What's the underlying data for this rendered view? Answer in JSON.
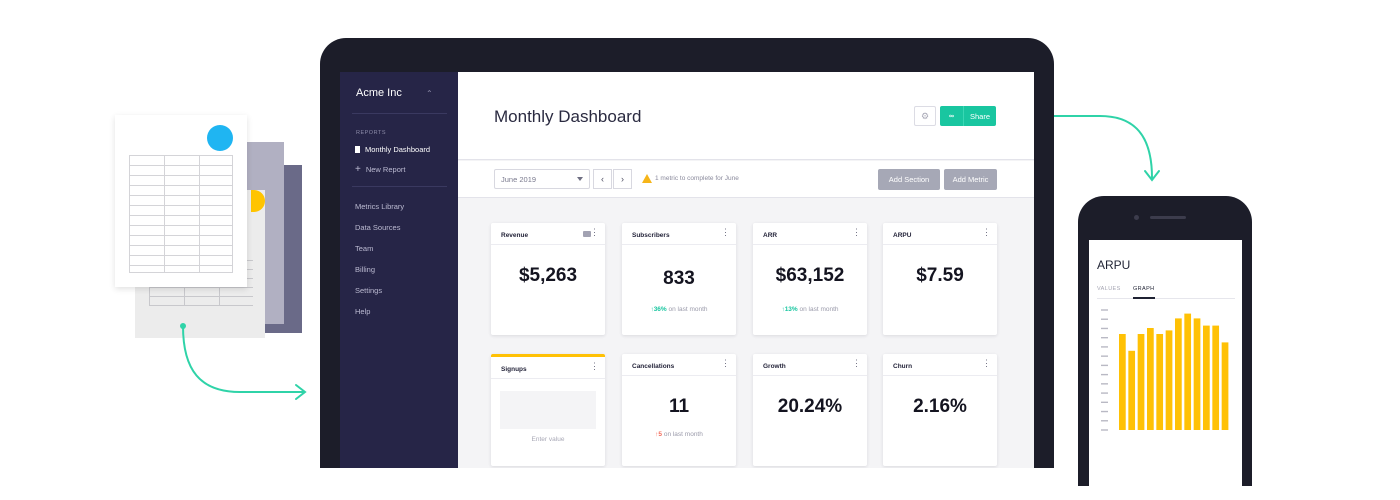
{
  "colors": {
    "accent": "#19c6a0",
    "sidebar": "#262547",
    "chart_bar": "#ffc105",
    "signups_accent": "#ffc105",
    "up": "#19c6a0",
    "down": "#f36b5a"
  },
  "sidebar": {
    "org_name": "Acme Inc",
    "section_label": "REPORTS",
    "reports": [
      {
        "label": "Monthly Dashboard",
        "icon": "document-icon",
        "active": true
      },
      {
        "label": "New Report",
        "icon": "plus-icon",
        "active": false
      }
    ],
    "items": [
      {
        "label": "Metrics Library"
      },
      {
        "label": "Data Sources"
      },
      {
        "label": "Team"
      },
      {
        "label": "Billing"
      },
      {
        "label": "Settings"
      },
      {
        "label": "Help"
      }
    ]
  },
  "header": {
    "title": "Monthly Dashboard",
    "share_label": "Share",
    "share_icon": "link-icon",
    "settings_icon": "gear-icon"
  },
  "toolbar": {
    "month": "June 2019",
    "warning": "1 metric to complete for June",
    "add_section": "Add Section",
    "add_metric": "Add Metric"
  },
  "cards": [
    {
      "title": "Revenue",
      "value": "$5,263"
    },
    {
      "title": "Subscribers",
      "value": "833",
      "delta": "36%",
      "delta_dir": "up",
      "delta_note": "on last month"
    },
    {
      "title": "ARR",
      "value": "$63,152",
      "delta": "13%",
      "delta_dir": "up",
      "delta_note": "on last month"
    },
    {
      "title": "ARPU",
      "value": "$7.59"
    },
    {
      "title": "Signups",
      "placeholder": "Enter value"
    },
    {
      "title": "Cancellations",
      "value": "11",
      "delta": "5",
      "delta_dir": "down",
      "delta_note": "on last month"
    },
    {
      "title": "Growth",
      "value": "20.24%"
    },
    {
      "title": "Churn",
      "value": "2.16%"
    }
  ],
  "phone": {
    "title": "ARPU",
    "tabs": [
      "VALUES",
      "GRAPH"
    ],
    "active_tab": "GRAPH"
  },
  "chart_data": {
    "type": "bar",
    "title": "ARPU",
    "values": [
      0.8,
      0.66,
      0.8,
      0.85,
      0.8,
      0.83,
      0.93,
      0.97,
      0.93,
      0.87,
      0.87,
      0.73
    ],
    "ylim": [
      0,
      1
    ],
    "grid": false
  }
}
